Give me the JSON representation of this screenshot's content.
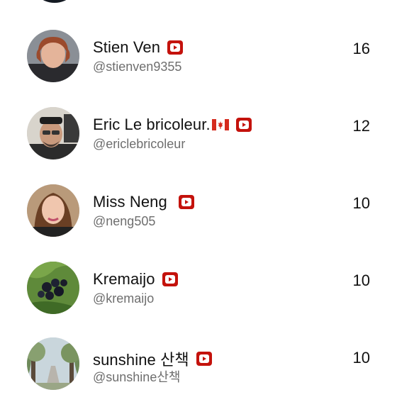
{
  "users": [
    {
      "name": "Stien Ven",
      "flag": "",
      "handle": "@stienven9355",
      "count": "16",
      "badge_icon": "youtube-icon"
    },
    {
      "name": "Eric Le bricoleur.",
      "flag": "canada-flag-icon",
      "handle": "@ericlebricoleur",
      "count": "12",
      "badge_icon": "youtube-icon"
    },
    {
      "name": " Miss Neng",
      "flag": "",
      "handle": "@neng505",
      "count": "10",
      "badge_icon": "youtube-icon"
    },
    {
      "name": "Kremaijo",
      "flag": "",
      "handle": "@kremaijo",
      "count": "10",
      "badge_icon": "youtube-icon"
    },
    {
      "name": "sunshine 산책",
      "flag": "",
      "handle": "@sunshine산책",
      "count": "10",
      "badge_icon": "youtube-icon"
    }
  ],
  "colors": {
    "badge_red": "#c4120c",
    "name_text": "#111111",
    "handle_text": "#6e6e6e"
  }
}
